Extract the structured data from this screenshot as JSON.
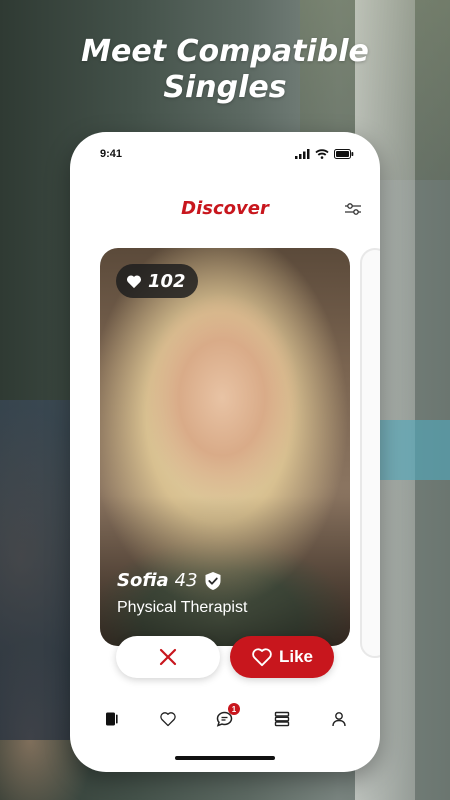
{
  "headline": {
    "line1": "Meet Compatible",
    "line2": "Singles"
  },
  "status_bar": {
    "time": "9:41"
  },
  "app": {
    "title": "Discover",
    "accent_color": "#c8161d",
    "filter_icon": "sliders-icon"
  },
  "profile_card": {
    "likes": "102",
    "name": "Sofia",
    "age": "43",
    "job": "Physical Therapist",
    "verified_icon": "shield-check-icon"
  },
  "actions": {
    "pass_icon": "close-icon",
    "like_label": "Like",
    "like_icon": "heart-icon"
  },
  "tab_bar": {
    "items": [
      {
        "name": "cards",
        "icon": "cards-icon",
        "active": true
      },
      {
        "name": "likes",
        "icon": "heart-icon",
        "active": false
      },
      {
        "name": "messages",
        "icon": "chat-icon",
        "active": false,
        "badge": "1"
      },
      {
        "name": "feed",
        "icon": "list-icon",
        "active": false
      },
      {
        "name": "profile",
        "icon": "user-icon",
        "active": false
      }
    ]
  }
}
